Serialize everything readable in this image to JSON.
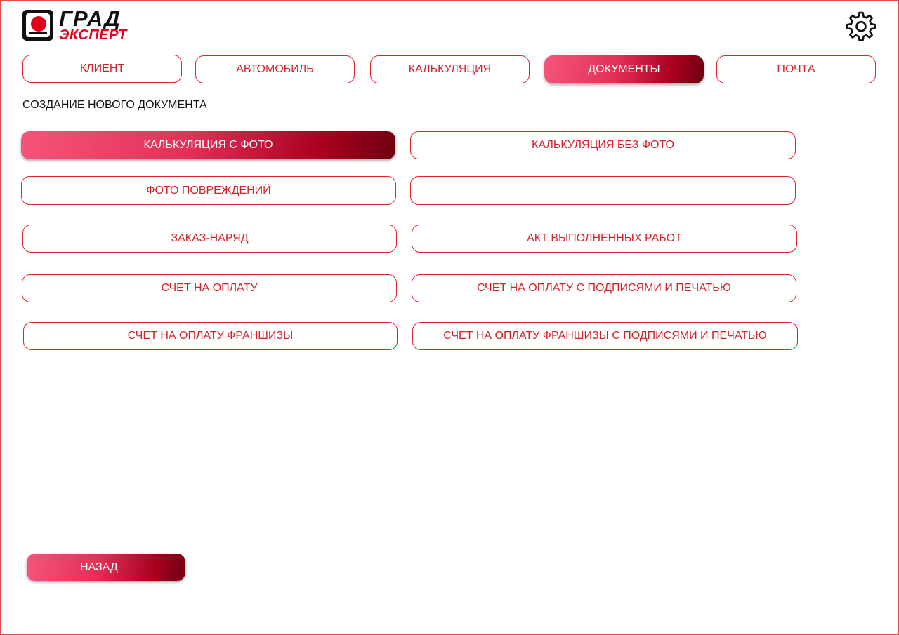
{
  "logo": {
    "line1": "ГРАД",
    "line2": "ЭКСПЕРТ"
  },
  "settings_icon": "gear-icon",
  "tabs": [
    {
      "label": "КЛИЕНТ",
      "active": false
    },
    {
      "label": "АВТОМОБИЛЬ",
      "active": false
    },
    {
      "label": "КАЛЬКУЛЯЦИЯ",
      "active": false
    },
    {
      "label": "ДОКУМЕНТЫ",
      "active": true
    },
    {
      "label": "ПОЧТА",
      "active": false
    }
  ],
  "section_title": "СОЗДАНИЕ НОВОГО ДОКУМЕНТА",
  "documents": {
    "left": [
      {
        "label": "КАЛЬКУЛЯЦИЯ С ФОТО",
        "active": true
      },
      {
        "label": "ФОТО ПОВРЕЖДЕНИЙ",
        "active": false
      },
      {
        "label": "ЗАКАЗ-НАРЯД",
        "active": false
      },
      {
        "label": "СЧЕТ НА ОПЛАТУ",
        "active": false
      },
      {
        "label": "СЧЕТ НА ОПЛАТУ ФРАНШИЗЫ",
        "active": false
      }
    ],
    "right": [
      {
        "label": "КАЛЬКУЛЯЦИЯ БЕЗ ФОТО",
        "active": false
      },
      {
        "label": "",
        "active": false
      },
      {
        "label": "АКТ ВЫПОЛНЕННЫХ РАБОТ",
        "active": false
      },
      {
        "label": "СЧЕТ НА ОПЛАТУ С ПОДПИСЯМИ И ПЕЧАТЬЮ",
        "active": false
      },
      {
        "label": "СЧЕТ НА ОПЛАТУ ФРАНШИЗЫ С ПОДПИСЯМИ И ПЕЧАТЬЮ",
        "active": false
      }
    ]
  },
  "back_button": "НАЗАД",
  "colors": {
    "accent": "#d2232a",
    "border": "#e0242c",
    "gradient_light": "#f5557a",
    "gradient_dark": "#6f0010"
  }
}
